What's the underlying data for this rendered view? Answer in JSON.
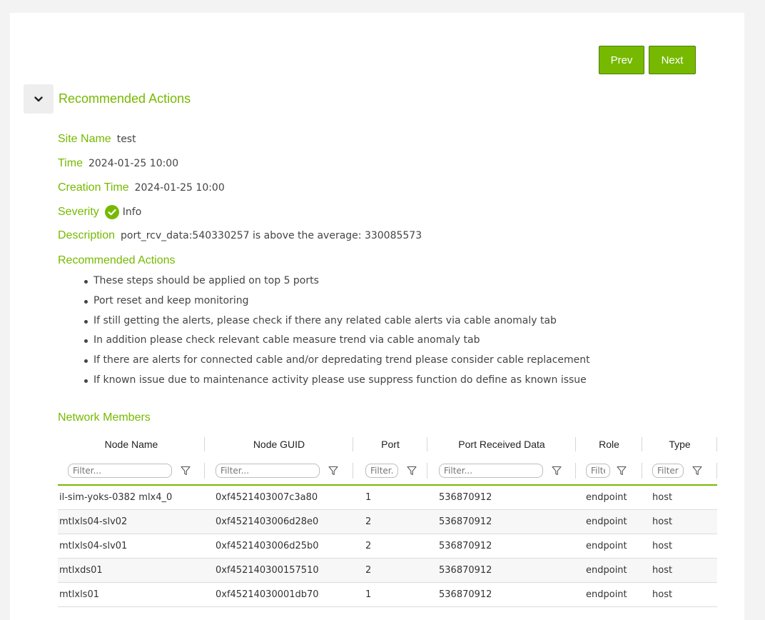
{
  "pager": {
    "prev_label": "Prev",
    "next_label": "Next"
  },
  "section": {
    "title": "Recommended Actions"
  },
  "details": {
    "site_name_label": "Site Name",
    "site_name": "test",
    "time_label": "Time",
    "time": "2024-01-25 10:00",
    "creation_time_label": "Creation Time",
    "creation_time": "2024-01-25 10:00",
    "severity_label": "Severity",
    "severity": "Info",
    "severity_color": "#76b900",
    "description_label": "Description",
    "description": "port_rcv_data:540330257 is above the average: 330085573",
    "actions_label": "Recommended Actions",
    "actions": [
      "These steps should be applied on top 5 ports",
      "Port reset and keep monitoring",
      "If still getting the alerts, please check if there any related cable alerts via cable anomaly tab",
      "In addition please check relevant cable measure trend via cable anomaly tab",
      "If there are alerts for connected cable and/or depredating trend please consider cable replacement",
      "If known issue due to maintenance activity please use suppress function do define as known issue"
    ]
  },
  "members": {
    "title": "Network Members",
    "columns": [
      "Node Name",
      "Node GUID",
      "Port",
      "Port Received Data",
      "Role",
      "Type"
    ],
    "filter_placeholders": [
      "Filter...",
      "Filter...",
      "Filter...",
      "Filter...",
      "Filter...",
      "Filter..."
    ],
    "rows": [
      [
        "il-sim-yoks-0382 mlx4_0",
        "0xf4521403007c3a80",
        "1",
        "536870912",
        "endpoint",
        "host"
      ],
      [
        "mtlxls04-slv02",
        "0xf4521403006d28e0",
        "2",
        "536870912",
        "endpoint",
        "host"
      ],
      [
        "mtlxls04-slv01",
        "0xf4521403006d25b0",
        "2",
        "536870912",
        "endpoint",
        "host"
      ],
      [
        "mtlxds01",
        "0xf452140300157510",
        "2",
        "536870912",
        "endpoint",
        "host"
      ],
      [
        "mtlxls01",
        "0xf45214030001db70",
        "1",
        "536870912",
        "endpoint",
        "host"
      ]
    ]
  },
  "colors": {
    "accent": "#76b900",
    "accent_border": "#4e7d00"
  },
  "icons": {
    "toggle": "chevron-down-icon",
    "severity": "check-circle-icon",
    "filter": "funnel-icon"
  }
}
